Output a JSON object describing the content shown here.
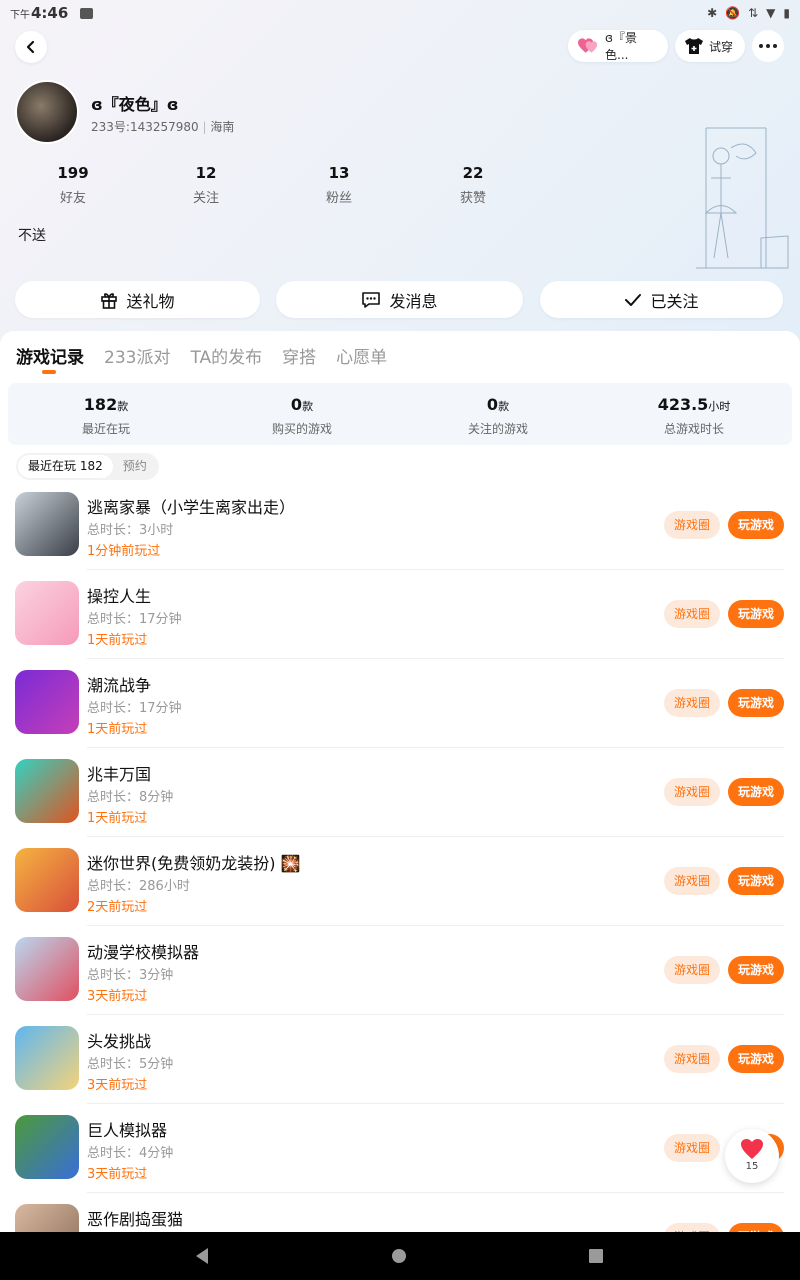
{
  "status_bar": {
    "time_prefix": "下午",
    "time": "4:46"
  },
  "top_bar": {
    "friend_pill_label": "ɞ『景色...",
    "try_on_label": "试穿"
  },
  "profile": {
    "nickname": "ɞ『夜色』ɞ",
    "uid_line": "233号:143257980",
    "location": "海南",
    "bio": "不送",
    "stats": [
      {
        "value": "199",
        "label": "好友"
      },
      {
        "value": "12",
        "label": "关注"
      },
      {
        "value": "13",
        "label": "粉丝"
      },
      {
        "value": "22",
        "label": "获赞"
      }
    ]
  },
  "actions": {
    "gift": "送礼物",
    "message": "发消息",
    "followed": "已关注"
  },
  "tabs": [
    "游戏记录",
    "233派对",
    "TA的发布",
    "穿搭",
    "心愿单"
  ],
  "summary": [
    {
      "value": "182",
      "unit": "款",
      "label": "最近在玩"
    },
    {
      "value": "0",
      "unit": "款",
      "label": "购买的游戏"
    },
    {
      "value": "0",
      "unit": "款",
      "label": "关注的游戏"
    },
    {
      "value": "423.5",
      "unit": "小时",
      "label": "总游戏时长"
    }
  ],
  "filter": {
    "recent": "最近在玩 182",
    "reserve": "预约"
  },
  "buttons": {
    "circle": "游戏圈",
    "play": "玩游戏"
  },
  "games": [
    {
      "name": "逃离家暴（小学生离家出走）",
      "duration": "总时长：3小时",
      "last": "1分钟前玩过",
      "color_a": "#c8d0d8",
      "color_b": "#3a3f47"
    },
    {
      "name": "操控人生",
      "duration": "总时长：17分钟",
      "last": "1天前玩过",
      "color_a": "#fbd3e0",
      "color_b": "#f59ab8"
    },
    {
      "name": "潮流战争",
      "duration": "总时长：17分钟",
      "last": "1天前玩过",
      "color_a": "#7a2bd6",
      "color_b": "#c63fb8"
    },
    {
      "name": "兆丰万国",
      "duration": "总时长：8分钟",
      "last": "1天前玩过",
      "color_a": "#34d1c2",
      "color_b": "#e0541f"
    },
    {
      "name": "迷你世界(免费领奶龙装扮) 🎇",
      "duration": "总时长：286小时",
      "last": "2天前玩过",
      "color_a": "#f5b342",
      "color_b": "#d9503a"
    },
    {
      "name": "动漫学校模拟器",
      "duration": "总时长：3分钟",
      "last": "3天前玩过",
      "color_a": "#b9d7ef",
      "color_b": "#e05060"
    },
    {
      "name": "头发挑战",
      "duration": "总时长：5分钟",
      "last": "3天前玩过",
      "color_a": "#5fb6f0",
      "color_b": "#f3d37a"
    },
    {
      "name": "巨人模拟器",
      "duration": "总时长：4分钟",
      "last": "3天前玩过",
      "color_a": "#4c9a3a",
      "color_b": "#3a6ed8"
    },
    {
      "name": "恶作剧捣蛋猫",
      "duration": "",
      "last": "",
      "color_a": "#d8b9a0",
      "color_b": "#8a6b58"
    }
  ],
  "like_fab": {
    "count": "15"
  },
  "colors": {
    "accent": "#ff7210",
    "accent_light": "#fde9dc",
    "summary_bg": "#f3f7fc"
  }
}
